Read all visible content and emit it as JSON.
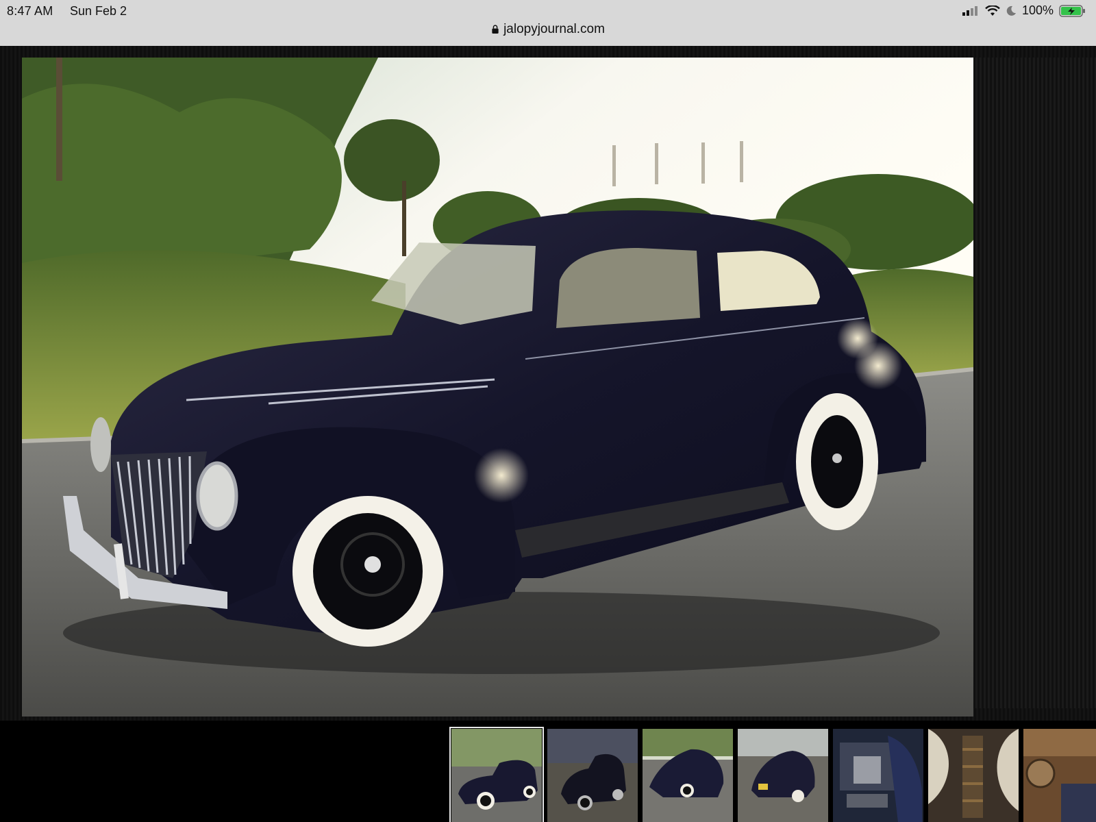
{
  "status_bar": {
    "time": "8:47 AM",
    "date": "Sun Feb 2",
    "battery": "100%",
    "icons": [
      "signal-icon",
      "wifi-icon",
      "moon-icon",
      "battery-icon"
    ]
  },
  "url_bar": {
    "url": "jalopyjournal.com",
    "icon": "lock-icon"
  },
  "gallery": {
    "main_image": "black 1939 Ford Deluxe two-door sedan with whitewall tires parked on asphalt",
    "selected_index": 0,
    "thumbnails": [
      {
        "subject": "front-three-quarter view at sunset"
      },
      {
        "subject": "side view at dusk"
      },
      {
        "subject": "rear three-quarter view"
      },
      {
        "subject": "rear view with license plate"
      },
      {
        "subject": "engine bay"
      },
      {
        "subject": "engine detail"
      },
      {
        "subject": "interior dashboard"
      }
    ]
  },
  "colors": {
    "status_bar_bg": "#d8d8d8",
    "car_body": "#161629",
    "battery_green": "#33c24a"
  }
}
